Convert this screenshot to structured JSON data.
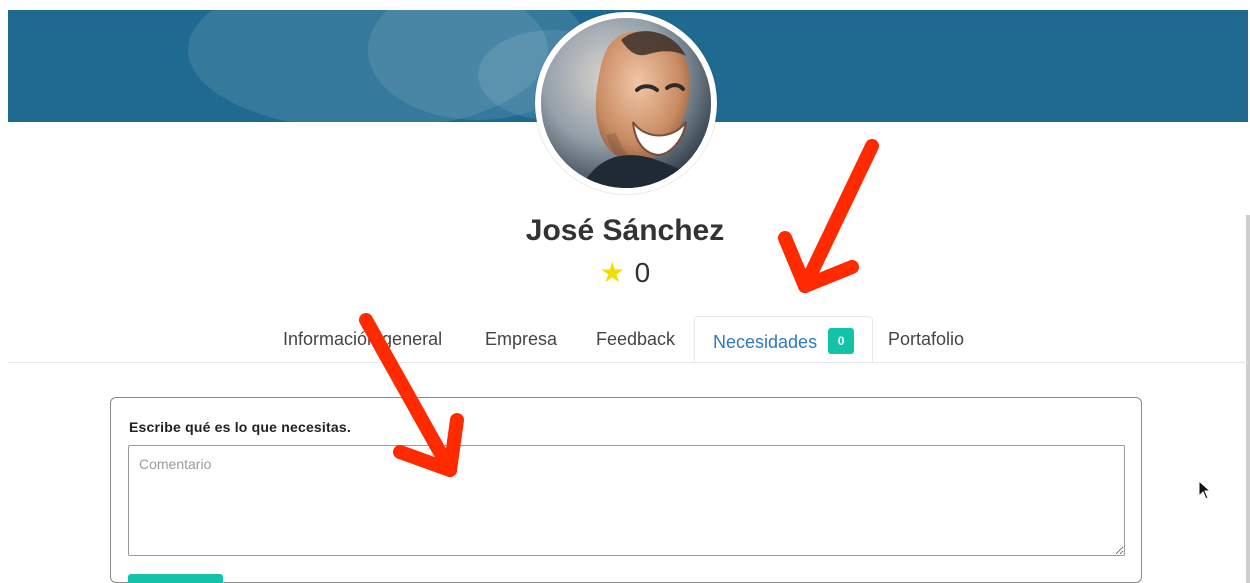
{
  "profile": {
    "name": "José Sánchez",
    "rating_star": "★",
    "rating_value": "0"
  },
  "tabs": [
    {
      "label": "Información general"
    },
    {
      "label": "Empresa"
    },
    {
      "label": "Feedback"
    },
    {
      "label": "Necesidades",
      "badge": "0",
      "active": true
    },
    {
      "label": "Portafolio"
    }
  ],
  "needs_panel": {
    "title": "Escribe qué es lo que necesitas.",
    "comment_placeholder": "Comentario"
  },
  "colors": {
    "cover": "#1f6a90",
    "accent_teal": "#12c3a8",
    "active_tab_text": "#2f78bf",
    "annotation_arrow": "#ff2a00",
    "star": "#f2dd00"
  },
  "icons": {
    "star_icon": "star-icon",
    "cursor_icon": "mouse-cursor-icon",
    "annotation_arrow_icon": "red-arrow-icon"
  }
}
